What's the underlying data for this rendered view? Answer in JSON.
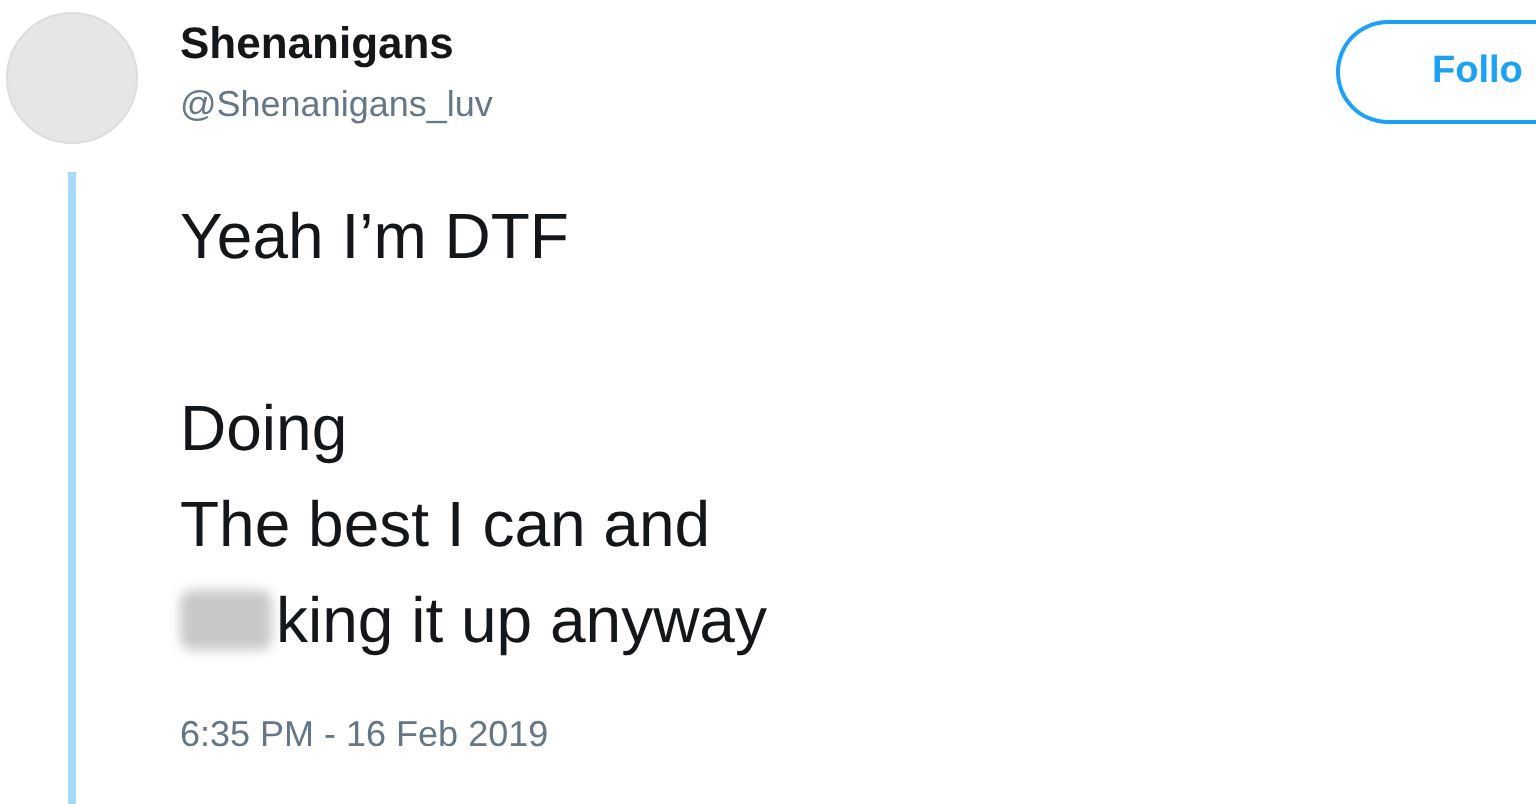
{
  "author": {
    "name": "Shenanigans",
    "handle": "@Shenanigans_luv"
  },
  "follow_button": {
    "label": "Follo"
  },
  "tweet": {
    "lines": [
      {
        "kind": "text",
        "text": "Yeah I’m DTF"
      },
      {
        "kind": "blank"
      },
      {
        "kind": "text",
        "text": "Doing"
      },
      {
        "kind": "text",
        "text": "The best I can and"
      },
      {
        "kind": "censored",
        "text": "king it up anyway"
      }
    ],
    "timestamp": "6:35 PM - 16 Feb 2019"
  }
}
